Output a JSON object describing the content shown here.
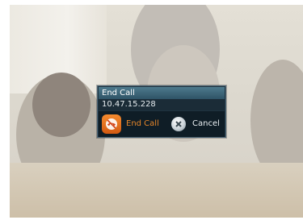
{
  "dialog": {
    "title": "End Call",
    "address": "10.47.15.228",
    "end_call_label": "End Call",
    "cancel_label": "Cancel"
  },
  "icons": {
    "end_call": "phone-hangup-icon",
    "cancel": "cancel-x-icon"
  },
  "colors": {
    "title_bar": "#3d6a7e",
    "end_call_accent": "#e4852a",
    "dialog_bg": "#1f3340"
  }
}
